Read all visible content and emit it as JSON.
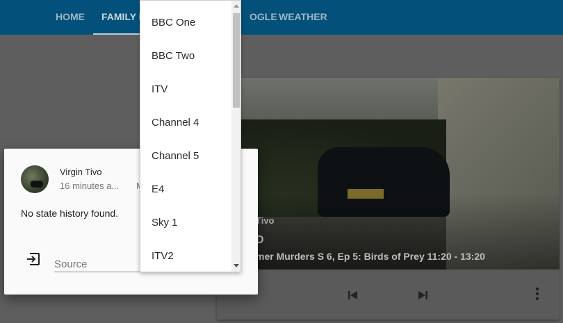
{
  "header": {
    "tabs": [
      {
        "label": "HOME"
      },
      {
        "label": "FAMILY R"
      },
      {
        "label": "OGLE"
      },
      {
        "label": "WEATHER"
      }
    ]
  },
  "media_card": {
    "source": "Tivo",
    "channel": "D",
    "now_playing": "mer Murders S 6, Ep 5: Birds of Prey 11:20 - 13:20",
    "controls": {
      "prev_icon": "skip-previous-icon",
      "next_icon": "skip-next-icon",
      "menu_icon": "more-vert-icon"
    }
  },
  "dialog": {
    "entity_name": "Virgin Tivo",
    "last_changed": "16 minutes a...",
    "extra": "M",
    "history_message": "No state history found.",
    "source_icon": "input-icon",
    "source_placeholder": "Source"
  },
  "dropdown": {
    "options": [
      "BBC One",
      "BBC Two",
      "ITV",
      "Channel 4",
      "Channel 5",
      "E4",
      "Sky 1",
      "ITV2"
    ]
  },
  "colors": {
    "header": "#03517a",
    "dialog_bg": "#fafafa",
    "dropdown_bg": "#ffffff"
  }
}
